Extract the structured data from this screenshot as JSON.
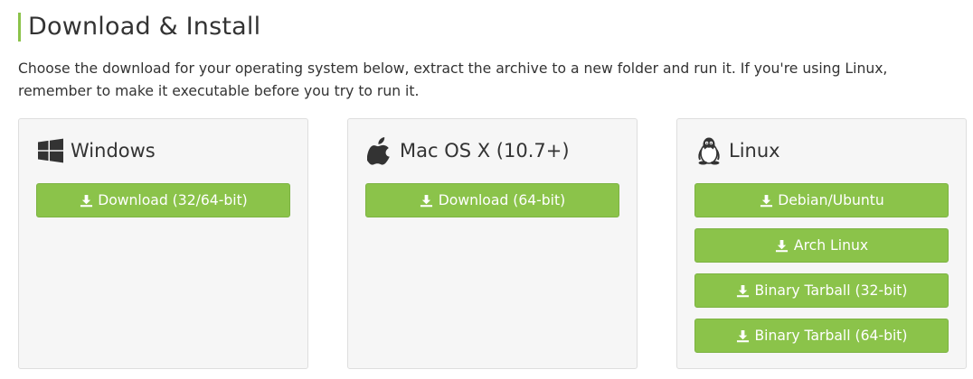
{
  "section": {
    "title": "Download & Install",
    "description": "Choose the download for your operating system below, extract the archive to a new folder and run it. If you're using Linux, remember to make it executable before you try to run it."
  },
  "platforms": {
    "windows": {
      "name": "Windows",
      "icon": "windows-logo-icon",
      "downloads": [
        {
          "label": "Download (32/64-bit)"
        }
      ]
    },
    "mac": {
      "name": "Mac OS X (10.7+)",
      "icon": "apple-logo-icon",
      "downloads": [
        {
          "label": "Download (64-bit)"
        }
      ]
    },
    "linux": {
      "name": "Linux",
      "icon": "tux-penguin-icon",
      "downloads": [
        {
          "label": "Debian/Ubuntu"
        },
        {
          "label": "Arch Linux"
        },
        {
          "label": "Binary Tarball (32-bit)"
        },
        {
          "label": "Binary Tarball (64-bit)"
        }
      ]
    }
  },
  "colors": {
    "accent": "#8bc34a",
    "button_text": "#ffffff",
    "panel_bg": "#f6f6f6",
    "panel_border": "#dedede",
    "text": "#333333"
  },
  "button_icon": "download-icon"
}
